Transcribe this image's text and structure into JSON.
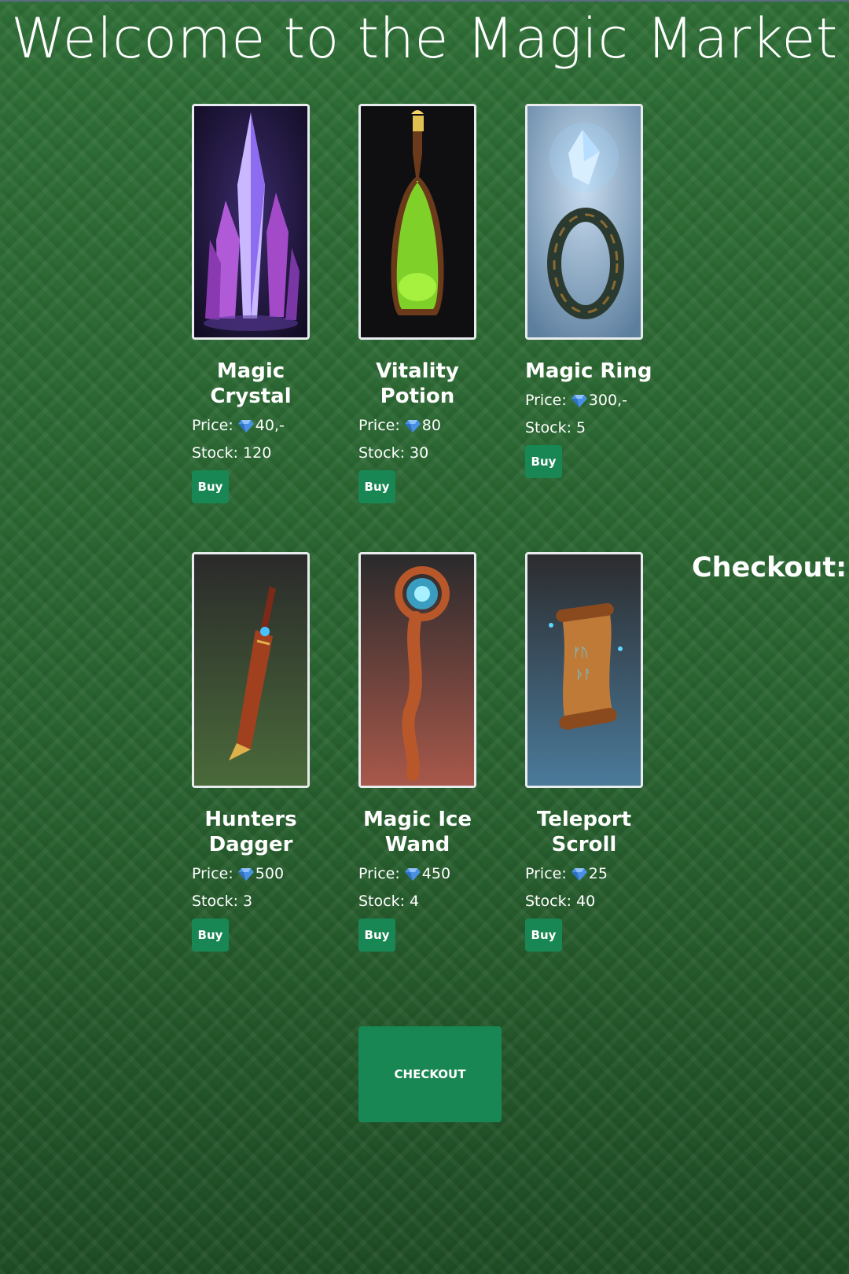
{
  "page": {
    "title": "Welcome to the Magic Market",
    "checkout_heading": "Checkout:",
    "checkout_button": "CHECKOUT"
  },
  "labels": {
    "price": "Price:",
    "stock_prefix": "Stock:",
    "buy": "Buy",
    "currency_icon": "diamond-icon"
  },
  "colors": {
    "button": "#198754",
    "background": "#2c6a33"
  },
  "products": [
    {
      "name": "Magic Crystal",
      "price": "40,-",
      "stock": "Stock: 120",
      "image": "purple-crystal-icon"
    },
    {
      "name": "Vitality Potion",
      "price": "80",
      "stock": "Stock: 30",
      "image": "green-potion-icon"
    },
    {
      "name": "Magic Ring",
      "price": "300,-",
      "stock": "Stock: 5",
      "image": "gem-ring-icon"
    },
    {
      "name": "Hunters Dagger",
      "price": "500",
      "stock": "Stock: 3",
      "image": "dagger-icon"
    },
    {
      "name": "Magic Ice Wand",
      "price": "450",
      "stock": "Stock: 4",
      "image": "ice-wand-icon"
    },
    {
      "name": "Teleport Scroll",
      "price": "25",
      "stock": "Stock: 40",
      "image": "rune-scroll-icon"
    }
  ]
}
